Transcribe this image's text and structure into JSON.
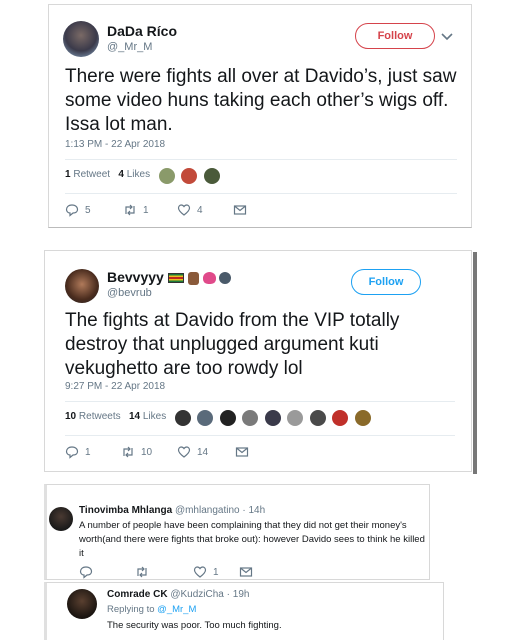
{
  "tweet1": {
    "name": "DaDa Ríco",
    "handle": "@_Mr_M",
    "follow": "Follow",
    "text": "There were fights all over at Davido’s, just saw some video huns taking each other’s wigs off. Issa lot man.",
    "timestamp": "1:13 PM - 22 Apr 2018",
    "retweets_count": "1",
    "retweets_label": "Retweet",
    "likes_count": "4",
    "likes_label": "Likes",
    "reply_count": "5",
    "retweet_action_count": "1",
    "like_action_count": "4"
  },
  "tweet2": {
    "name": "Bevvyyy",
    "handle": "@bevrub",
    "follow": "Follow",
    "text": "The fights at Davido from the VIP totally destroy that unplugged argument kuti vekughetto are too rowdy lol",
    "timestamp": "9:27 PM - 22 Apr 2018",
    "retweets_count": "10",
    "retweets_label": "Retweets",
    "likes_count": "14",
    "likes_label": "Likes",
    "reply_count": "1",
    "retweet_action_count": "10",
    "like_action_count": "14"
  },
  "reply1": {
    "name": "Tinovimba Mhlanga",
    "handle": "@mhlangatino",
    "time": "· 14h",
    "text": "A number of people have been complaining that they did not get their money's worth(and there were fights that broke out): however Davido sees to think he killed it",
    "like_count": "1"
  },
  "reply2": {
    "name": "Comrade CK",
    "handle": "@KudziCha",
    "time": "· 19h",
    "replying_label": "Replying to",
    "replying_handle": "@_Mr_M",
    "text": "The security was poor. Too much fighting."
  },
  "colors": {
    "follow_red": "#d5434b",
    "follow_blue": "#1da1f2",
    "secondary": "#657786"
  }
}
